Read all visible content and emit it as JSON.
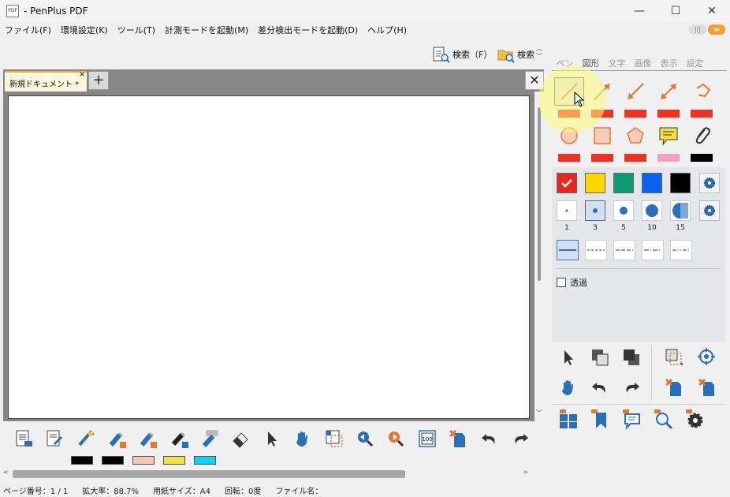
{
  "window": {
    "title": "- PenPlus PDF",
    "app_icon_text": "PDF",
    "minimize": "—",
    "maximize": "☐",
    "close": "✕"
  },
  "menu": {
    "items": [
      "ファイル(F)",
      "環境設定(K)",
      "ツール(T)",
      "計測モードを起動(M)",
      "差分検出モードを起動(D)",
      "ヘルプ(H)"
    ],
    "mini_left": "|||",
    "mini_right": "≫"
  },
  "toolbar": {
    "search_page": "検索（F）",
    "search_folder": "検索"
  },
  "tabs": {
    "doc_tab": "新規ドキュメント *",
    "tab_close": "×",
    "add": "+",
    "close_all": "✕"
  },
  "bottom_swatches": [
    "#000000",
    "#000000",
    "#f8c4b4",
    "#f4e04a",
    "#14d0f0"
  ],
  "status": {
    "page": "ページ番号：1 / 1",
    "zoom": "拡大率：88.7%",
    "paper": "用紙サイズ：A4",
    "rotation": "回転：0度",
    "filename": "ファイル名："
  },
  "panel": {
    "tabs": [
      "ペン",
      "図形",
      "文字",
      "画像",
      "表示",
      "設定"
    ],
    "active_tab": "図形",
    "colors": [
      "#e8251f",
      "#ffd600",
      "#0f9a72",
      "#0a62f0",
      "#000000"
    ],
    "sizes": [
      "1",
      "3",
      "5",
      "10",
      "15"
    ],
    "transparent_label": "透過",
    "shape_bar_colors": [
      "#f03020",
      "#f03020",
      "#f03020",
      "#f03020",
      "#f03020",
      "#f03020",
      "#f03020",
      "#f03020",
      "#f0a0c0",
      "#000000"
    ]
  },
  "colors": {
    "accent": "#f0a030",
    "red": "#e8251f",
    "icon_blue": "#2a6fb8",
    "icon_orange": "#e07838"
  }
}
